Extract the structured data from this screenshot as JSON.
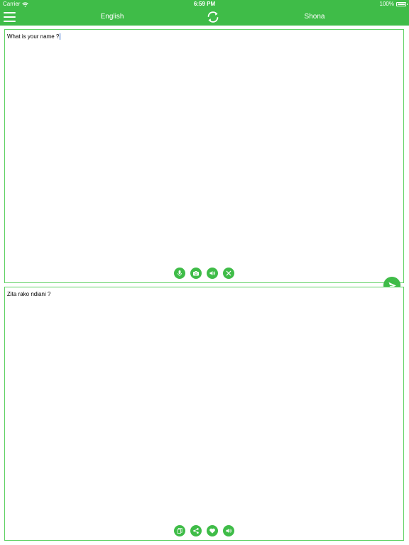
{
  "status_bar": {
    "carrier": "Carrier",
    "time": "6:59 PM",
    "battery": "100%"
  },
  "nav": {
    "source_language": "English",
    "target_language": "Shona"
  },
  "input_panel": {
    "text": "What is your name ?",
    "actions": [
      "microphone-icon",
      "camera-icon",
      "speaker-icon",
      "clear-icon"
    ]
  },
  "output_panel": {
    "text": "Zita rako ndiani ?",
    "actions": [
      "copy-icon",
      "share-icon",
      "favorite-icon",
      "speaker-icon"
    ]
  },
  "colors": {
    "accent": "#3fbc48",
    "panel_border": "#5ed163"
  },
  "send_button_icon": "send-icon"
}
